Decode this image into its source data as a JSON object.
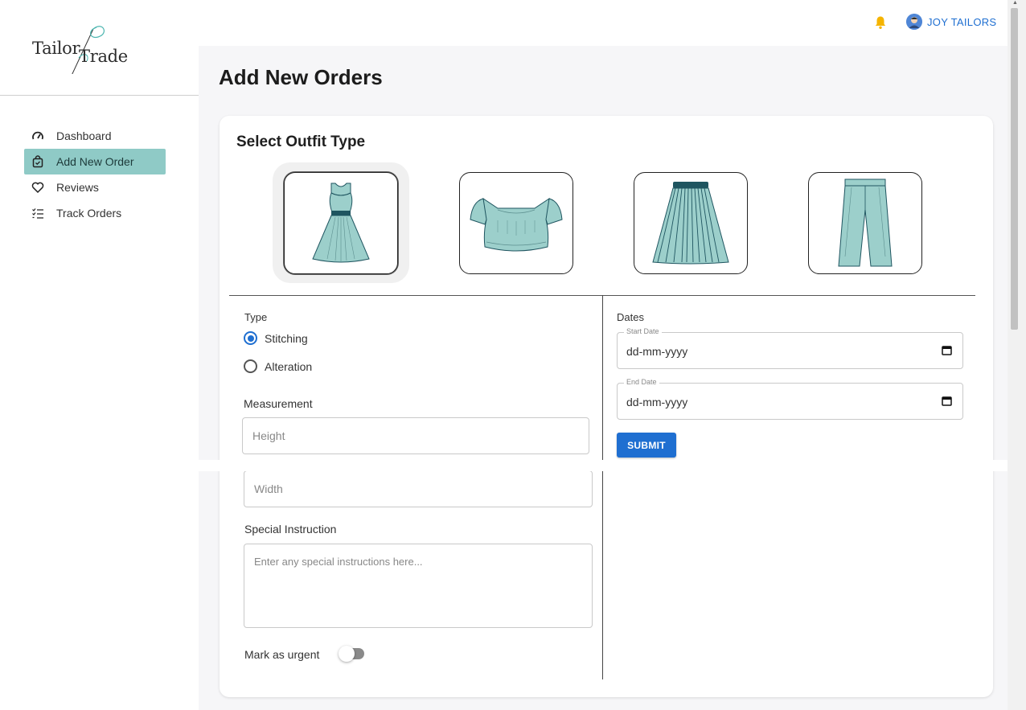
{
  "app": {
    "logo_part1": "Tailor",
    "logo_part2": "Trade"
  },
  "sidebar": {
    "items": [
      {
        "label": "Dashboard",
        "icon": "gauge-icon",
        "active": false
      },
      {
        "label": "Add New Order",
        "icon": "shopping-bag-icon",
        "active": true
      },
      {
        "label": "Reviews",
        "icon": "heart-icon",
        "active": false
      },
      {
        "label": "Track Orders",
        "icon": "checklist-icon",
        "active": false
      }
    ]
  },
  "header": {
    "user_name": "JOY TAILORS",
    "bell_color": "#f5b400"
  },
  "page": {
    "title": "Add New Orders"
  },
  "outfits": {
    "title": "Select Outfit Type",
    "items": [
      {
        "name": "dress",
        "selected": true
      },
      {
        "name": "crop-top",
        "selected": false
      },
      {
        "name": "skirt",
        "selected": false
      },
      {
        "name": "trousers",
        "selected": false
      }
    ]
  },
  "form": {
    "type_label": "Type",
    "type_options": [
      {
        "label": "Stitching",
        "checked": true
      },
      {
        "label": "Alteration",
        "checked": false
      }
    ],
    "measurement_label": "Measurement",
    "height_placeholder": "Height",
    "width_placeholder": "Width",
    "special_label": "Special Instruction",
    "special_placeholder": "Enter any special instructions here...",
    "urgent_label": "Mark as urgent",
    "urgent": false,
    "dates_label": "Dates",
    "start_date_label": "Start Date",
    "start_date_value": "dd-mm-yyyy",
    "end_date_label": "End Date",
    "end_date_value": "dd-mm-yyyy",
    "submit_label": "SUBMIT"
  },
  "colors": {
    "accent": "#1f6fd1",
    "sidebar_active": "#8fcac6",
    "garment": "#9ccfcb",
    "garment_dark": "#1f5560"
  }
}
